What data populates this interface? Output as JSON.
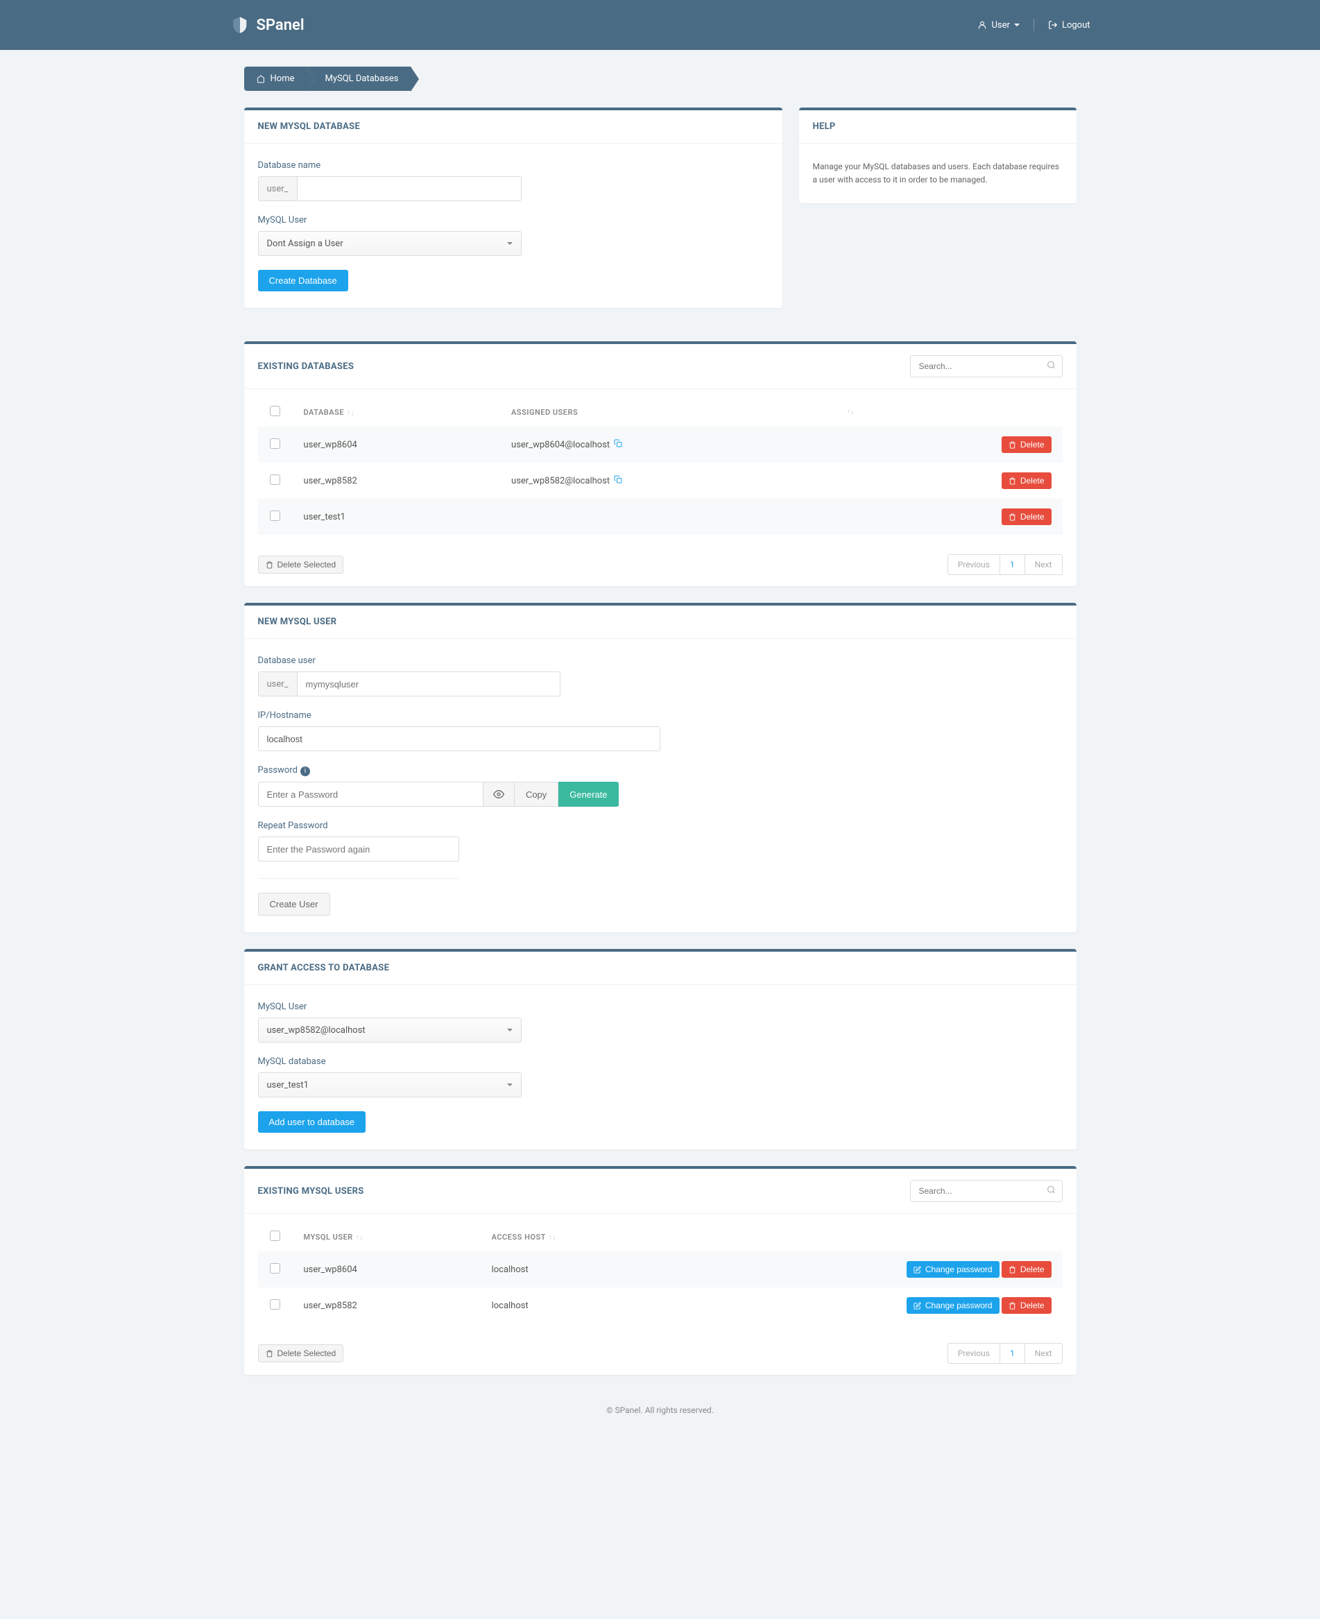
{
  "header": {
    "logo": "SPanel",
    "user_label": "User",
    "logout_label": "Logout"
  },
  "breadcrumb": {
    "home": "Home",
    "current": "MySQL Databases"
  },
  "help": {
    "title": "HELP",
    "text": "Manage your MySQL databases and users. Each database requires a user with access to it in order to be managed."
  },
  "new_db": {
    "title": "NEW MYSQL DATABASE",
    "name_label": "Database name",
    "name_prefix": "user_",
    "user_label": "MySQL User",
    "user_selected": "Dont Assign a User",
    "create_btn": "Create Database"
  },
  "existing_db": {
    "title": "EXISTING DATABASES",
    "search_placeholder": "Search...",
    "col_database": "DATABASE",
    "col_assigned": "ASSIGNED USERS",
    "delete_btn": "Delete",
    "rows": [
      {
        "db": "user_wp8604",
        "assigned": "user_wp8604@localhost"
      },
      {
        "db": "user_wp8582",
        "assigned": "user_wp8582@localhost"
      },
      {
        "db": "user_test1",
        "assigned": ""
      }
    ],
    "delete_selected": "Delete Selected",
    "prev": "Previous",
    "page": "1",
    "next": "Next"
  },
  "new_user": {
    "title": "NEW MYSQL USER",
    "user_label": "Database user",
    "user_prefix": "user_",
    "user_placeholder": "mymysqluser",
    "host_label": "IP/Hostname",
    "host_value": "localhost",
    "password_label": "Password",
    "password_placeholder": "Enter a Password",
    "copy_btn": "Copy",
    "generate_btn": "Generate",
    "repeat_label": "Repeat Password",
    "repeat_placeholder": "Enter the Password again",
    "create_btn": "Create User"
  },
  "grant": {
    "title": "GRANT ACCESS TO DATABASE",
    "user_label": "MySQL User",
    "user_selected": "user_wp8582@localhost",
    "db_label": "MySQL database",
    "db_selected": "user_test1",
    "add_btn": "Add user to database"
  },
  "existing_users": {
    "title": "EXISTING MYSQL USERS",
    "search_placeholder": "Search...",
    "col_user": "MYSQL USER",
    "col_host": "ACCESS HOST",
    "change_pw_btn": "Change password",
    "delete_btn": "Delete",
    "rows": [
      {
        "user": "user_wp8604",
        "host": "localhost"
      },
      {
        "user": "user_wp8582",
        "host": "localhost"
      }
    ],
    "delete_selected": "Delete Selected",
    "prev": "Previous",
    "page": "1",
    "next": "Next"
  },
  "footer": "© SPanel. All rights reserved."
}
